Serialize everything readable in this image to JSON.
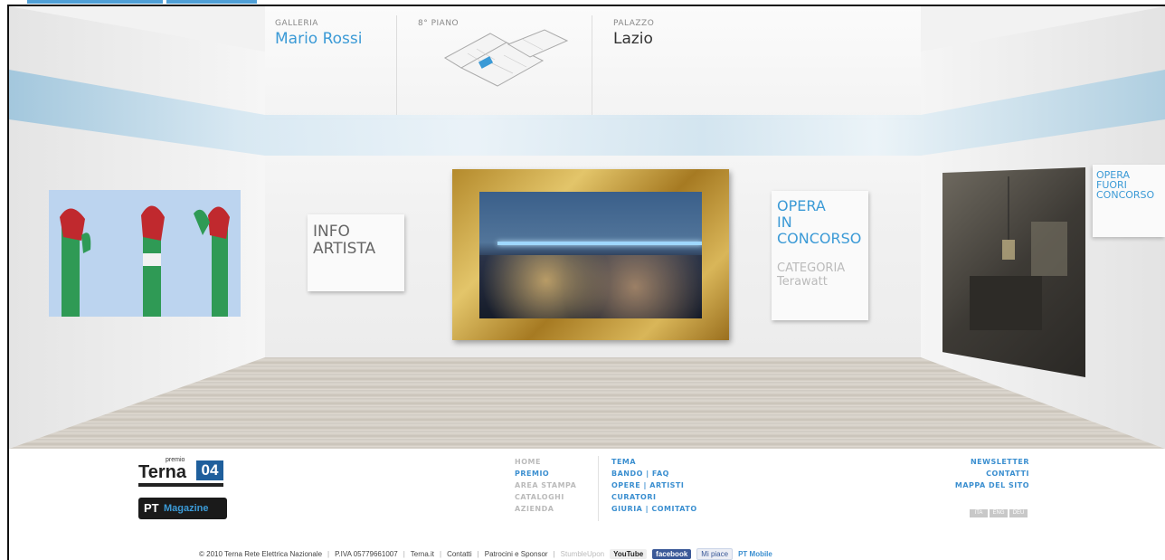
{
  "header": {
    "galleria_label": "GALLERIA",
    "galleria_value": "Mario Rossi",
    "piano_label": "8° PIANO",
    "palazzo_label": "PALAZZO",
    "palazzo_value": "Lazio"
  },
  "room": {
    "info_line1": "INFO",
    "info_line2": "ARTISTA",
    "opera_line1": "OPERA",
    "opera_line2": "IN",
    "opera_line3": "CONCORSO",
    "categoria_label": "CATEGORIA",
    "categoria_value": "Terawatt",
    "fuori_line1": "OPERA",
    "fuori_line2": "FUORI",
    "fuori_line3": "CONCORSO"
  },
  "logos": {
    "terna_small": "premio",
    "terna_name": "Terna",
    "terna_num": "04",
    "pt_name": "PT",
    "pt_suffix": "Magazine"
  },
  "nav": {
    "col1": [
      "HOME",
      "PREMIO",
      "AREA STAMPA",
      "CATALOGHI",
      "AZIENDA"
    ],
    "col2": [
      "TEMA",
      "BANDO | FAQ",
      "OPERE | ARTISTI",
      "CURATORI",
      "GIURIA | COMITATO"
    ],
    "col3": [
      "NEWSLETTER",
      "CONTATTI",
      "MAPPA DEL SITO"
    ]
  },
  "lang": [
    "ITA",
    "ENG",
    "DEU"
  ],
  "footer": {
    "copyright": "© 2010 Terna Rete Elettrica Nazionale",
    "piva": "P.IVA 05779661007",
    "terna_link": "Terna.it",
    "contatti": "Contatti",
    "patrocini": "Patrocini e Sponsor",
    "stumble": "StumbleUpon",
    "youtube": "YouTube",
    "facebook": "facebook",
    "mi_piace": "Mi piace",
    "mobile": "PT Mobile"
  },
  "colors": {
    "accent": "#3b9ad6",
    "nav_gray": "#bbbbbb",
    "frame_gold": "#c9a44a"
  }
}
